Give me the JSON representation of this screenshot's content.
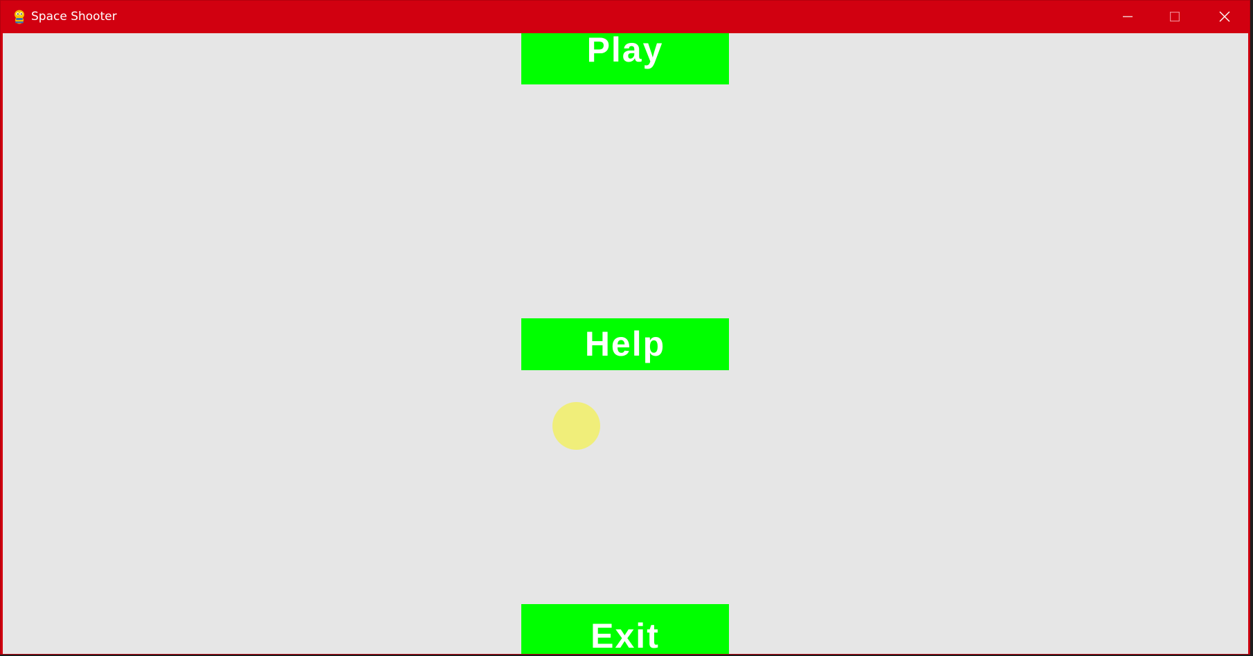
{
  "window": {
    "title": "Space Shooter",
    "icon": "pygame-snake-icon",
    "controls": {
      "minimize_icon": "minimize-icon",
      "maximize_icon": "maximize-icon",
      "close_icon": "close-icon"
    },
    "titlebar_color": "#d10010"
  },
  "game": {
    "background_color": "#e6e6e6",
    "menu": {
      "button_color": "#00ff00",
      "button_text_color": "#ffffff",
      "play_label": "Play",
      "help_label": "Help",
      "exit_label": "Exit"
    },
    "pointer_color": "#f0ee7a"
  }
}
